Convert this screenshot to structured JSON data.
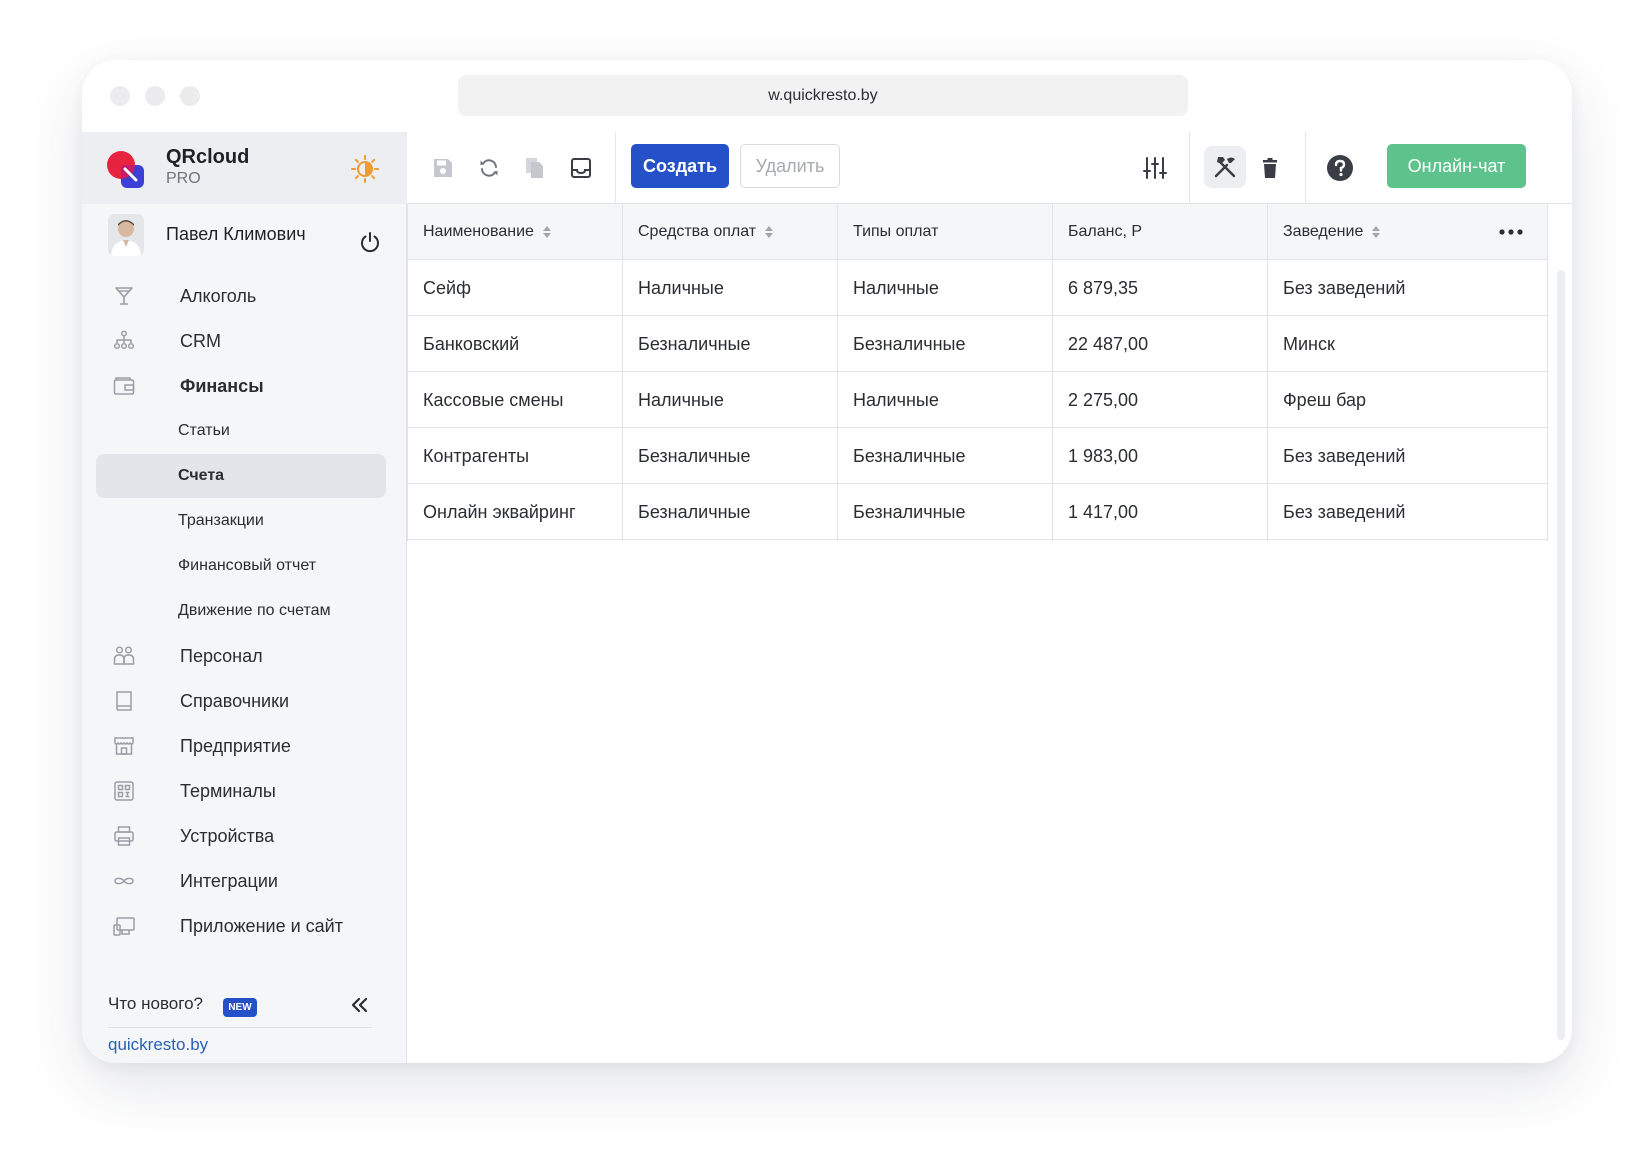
{
  "browser": {
    "url": "w.quickresto.by"
  },
  "brand": {
    "name": "QRcloud",
    "tier": "PRO"
  },
  "user": {
    "name": "Павел Климович"
  },
  "nav": {
    "items": [
      {
        "label": "Алкоголь",
        "icon": "glass-icon"
      },
      {
        "label": "CRM",
        "icon": "org-chart-icon"
      },
      {
        "label": "Финансы",
        "icon": "wallet-icon"
      },
      {
        "label": "Персонал",
        "icon": "people-icon"
      },
      {
        "label": "Справочники",
        "icon": "book-icon"
      },
      {
        "label": "Предприятие",
        "icon": "store-icon"
      },
      {
        "label": "Терминалы",
        "icon": "qr-icon"
      },
      {
        "label": "Устройства",
        "icon": "printer-icon"
      },
      {
        "label": "Интеграции",
        "icon": "infinity-icon"
      },
      {
        "label": "Приложение и сайт",
        "icon": "devices-icon"
      }
    ],
    "finance_sub": [
      "Статьи",
      "Счета",
      "Транзакции",
      "Финансовый отчет",
      "Движение по счетам"
    ],
    "active_sub": "Счета"
  },
  "footer": {
    "whats_new": "Что нового?",
    "new_badge": "NEW",
    "site": "quickresto.by"
  },
  "toolbar": {
    "create_label": "Создать",
    "delete_label": "Удалить",
    "chat_label": "Онлайн-чат"
  },
  "table": {
    "headers": [
      "Наименование",
      "Средства оплат",
      "Типы оплат",
      "Баланс, Р",
      "Заведение"
    ],
    "rows": [
      [
        "Сейф",
        "Наличные",
        "Наличные",
        "6 879,35",
        "Без заведений"
      ],
      [
        "Банковский",
        "Безналичные",
        "Безналичные",
        "22 487,00",
        "Минск"
      ],
      [
        "Кассовые смены",
        "Наличные",
        "Наличные",
        "2 275,00",
        "Фреш бар"
      ],
      [
        "Контрагенты",
        "Безналичные",
        "Безналичные",
        "1 983,00",
        "Без заведений"
      ],
      [
        "Онлайн эквайринг",
        "Безналичные",
        "Безналичные",
        "1 417,00",
        "Без заведений"
      ]
    ]
  },
  "colors": {
    "primary": "#2450c8",
    "chat": "#5ec28c",
    "link": "#2b5fb8",
    "theme_icon": "#f29a2e"
  }
}
